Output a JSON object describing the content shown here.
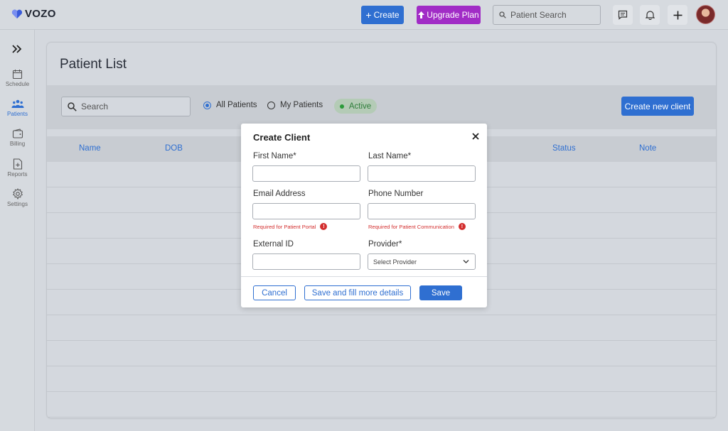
{
  "app": {
    "brand": "VOZO"
  },
  "header": {
    "create_label": "Create",
    "upgrade_label": "Upgrade Plan",
    "search_placeholder": "Patient Search"
  },
  "sidebar": {
    "items": [
      {
        "label": "Schedule"
      },
      {
        "label": "Patients"
      },
      {
        "label": "Billing"
      },
      {
        "label": "Reports"
      },
      {
        "label": "Settings"
      }
    ]
  },
  "page": {
    "title": "Patient List",
    "search_placeholder": "Search",
    "filters": {
      "all_patients": "All Patients",
      "my_patients": "My Patients",
      "active": "Active"
    },
    "create_new_client": "Create new client",
    "columns": [
      "Name",
      "DOB",
      "",
      "Status",
      "Note"
    ]
  },
  "modal": {
    "title": "Create Client",
    "first_name_label": "First Name*",
    "last_name_label": "Last Name*",
    "email_label": "Email Address",
    "phone_label": "Phone Number",
    "email_hint": "Required for Patient Portal",
    "phone_hint": "Required for Patient Communication",
    "external_id_label": "External ID",
    "provider_label": "Provider*",
    "provider_placeholder": "Select Provider",
    "cancel_label": "Cancel",
    "save_more_label": "Save and fill more details",
    "save_label": "Save"
  },
  "colors": {
    "primary": "#2f6fd1",
    "upgrade": "#a12cc6",
    "error": "#d32f2f",
    "active_green": "#2b9a3a"
  }
}
